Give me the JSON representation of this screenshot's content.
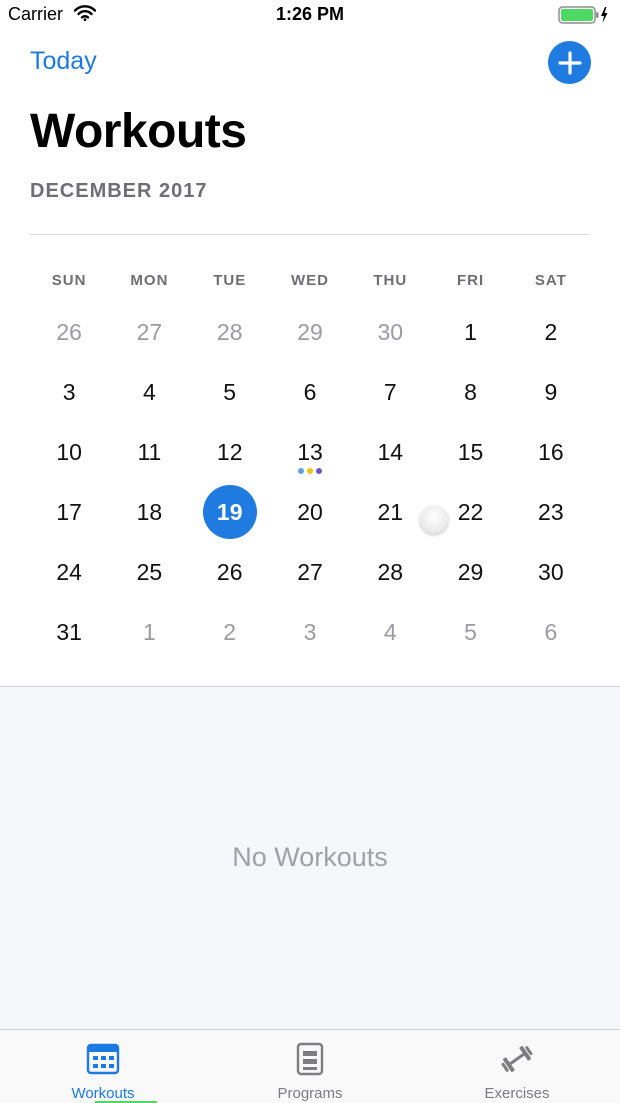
{
  "status_bar": {
    "carrier": "Carrier",
    "time": "1:26 PM"
  },
  "header": {
    "today_label": "Today",
    "title": "Workouts",
    "month": "DECEMBER 2017"
  },
  "calendar": {
    "weekdays": [
      "SUN",
      "MON",
      "TUE",
      "WED",
      "THU",
      "FRI",
      "SAT"
    ],
    "days": [
      {
        "label": "26",
        "current_month": false
      },
      {
        "label": "27",
        "current_month": false
      },
      {
        "label": "28",
        "current_month": false
      },
      {
        "label": "29",
        "current_month": false
      },
      {
        "label": "30",
        "current_month": false
      },
      {
        "label": "1",
        "current_month": true
      },
      {
        "label": "2",
        "current_month": true
      },
      {
        "label": "3",
        "current_month": true
      },
      {
        "label": "4",
        "current_month": true
      },
      {
        "label": "5",
        "current_month": true
      },
      {
        "label": "6",
        "current_month": true
      },
      {
        "label": "7",
        "current_month": true
      },
      {
        "label": "8",
        "current_month": true
      },
      {
        "label": "9",
        "current_month": true
      },
      {
        "label": "10",
        "current_month": true
      },
      {
        "label": "11",
        "current_month": true
      },
      {
        "label": "12",
        "current_month": true
      },
      {
        "label": "13",
        "current_month": true,
        "event_dots": [
          "#5ba2e8",
          "#f0c419",
          "#6b54c7"
        ]
      },
      {
        "label": "14",
        "current_month": true
      },
      {
        "label": "15",
        "current_month": true
      },
      {
        "label": "16",
        "current_month": true
      },
      {
        "label": "17",
        "current_month": true
      },
      {
        "label": "18",
        "current_month": true
      },
      {
        "label": "19",
        "current_month": true,
        "selected": true
      },
      {
        "label": "20",
        "current_month": true
      },
      {
        "label": "21",
        "current_month": true
      },
      {
        "label": "22",
        "current_month": true
      },
      {
        "label": "23",
        "current_month": true
      },
      {
        "label": "24",
        "current_month": true
      },
      {
        "label": "25",
        "current_month": true
      },
      {
        "label": "26",
        "current_month": true
      },
      {
        "label": "27",
        "current_month": true
      },
      {
        "label": "28",
        "current_month": true
      },
      {
        "label": "29",
        "current_month": true
      },
      {
        "label": "30",
        "current_month": true
      },
      {
        "label": "31",
        "current_month": true
      },
      {
        "label": "1",
        "current_month": false
      },
      {
        "label": "2",
        "current_month": false
      },
      {
        "label": "3",
        "current_month": false
      },
      {
        "label": "4",
        "current_month": false
      },
      {
        "label": "5",
        "current_month": false
      },
      {
        "label": "6",
        "current_month": false
      }
    ]
  },
  "empty_state": {
    "text": "No Workouts"
  },
  "tab_bar": {
    "tabs": [
      {
        "label": "Workouts",
        "icon": "calendar-icon",
        "active": true
      },
      {
        "label": "Programs",
        "icon": "document-icon",
        "active": false
      },
      {
        "label": "Exercises",
        "icon": "dumbbell-icon",
        "active": false
      }
    ]
  },
  "colors": {
    "accent": "#1f7be0",
    "tab_indicator": "#4cd964",
    "battery": "#4cd964"
  }
}
